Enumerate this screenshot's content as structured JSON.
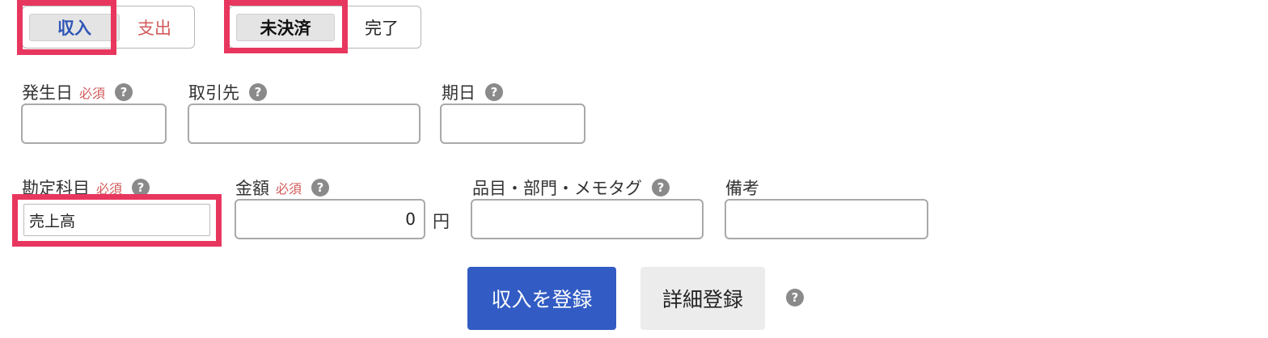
{
  "type_toggle": {
    "income_label": "収入",
    "expense_label": "支出",
    "active": "income"
  },
  "status_toggle": {
    "unsettled_label": "未決済",
    "complete_label": "完了",
    "active": "unsettled"
  },
  "fields": {
    "issue_date": {
      "label": "発生日",
      "required_label": "必須",
      "value": ""
    },
    "partner": {
      "label": "取引先",
      "value": ""
    },
    "due_date": {
      "label": "期日",
      "value": ""
    },
    "account_item": {
      "label": "勘定科目",
      "required_label": "必須",
      "value": "売上高"
    },
    "amount": {
      "label": "金額",
      "required_label": "必須",
      "value": "0",
      "unit": "円"
    },
    "item_tags": {
      "label": "品目・部門・メモタグ",
      "value": ""
    },
    "notes": {
      "label": "備考",
      "value": ""
    }
  },
  "actions": {
    "register_label": "収入を登録",
    "detail_label": "詳細登録"
  },
  "help_glyph": "?",
  "colors": {
    "highlight": "#e8375f",
    "primary": "#325cc4",
    "income_text": "#2f55b5",
    "expense_text": "#d25a5a",
    "required_text": "#d25a5a",
    "help_icon": "#8a8a8a"
  }
}
